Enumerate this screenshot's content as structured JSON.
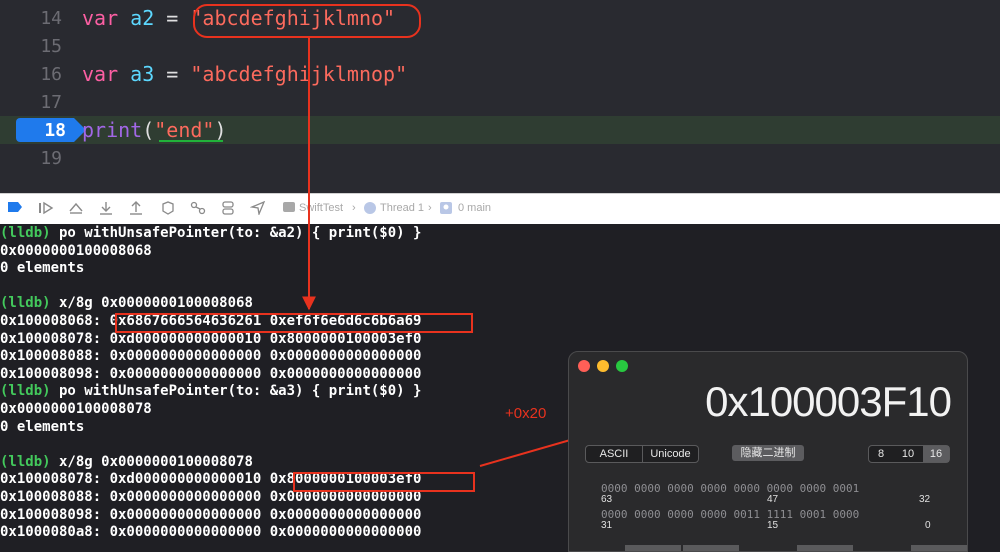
{
  "editor": {
    "lines": [
      {
        "num": "14",
        "kw": "var",
        "name": "a2",
        "eq": " = ",
        "str": "\"abcdefghijklmno\""
      },
      {
        "num": "15"
      },
      {
        "num": "16",
        "kw": "var",
        "name": "a3",
        "eq": " = ",
        "str": "\"abcdefghijklmnop\""
      },
      {
        "num": "17"
      },
      {
        "num": "18",
        "fn": "print",
        "open": "(",
        "str": "\"end\"",
        "close": ")"
      },
      {
        "num": "19"
      }
    ]
  },
  "debug_bar": {
    "target": "SwiftTest",
    "thread": "Thread 1",
    "frame": "0 main",
    "icons": [
      "breakpoint-icon",
      "continue-icon",
      "step-over-icon",
      "step-into-icon",
      "step-out-icon",
      "memory-graph-icon",
      "view-hierarchy-icon",
      "environment-icon",
      "location-icon"
    ]
  },
  "console": {
    "prompt": "(lldb)",
    "lines": [
      {
        "prompt": true,
        "text": " po withUnsafePointer(to: &a2) { print($0) }"
      },
      {
        "text": "0x0000000100008068"
      },
      {
        "text": "0 elements"
      },
      {
        "text": ""
      },
      {
        "prompt": true,
        "text": " x/8g 0x0000000100008068"
      },
      {
        "text": "0x100008068: 0x6867666564636261 0xef6f6e6d6c6b6a69"
      },
      {
        "text": "0x100008078: 0xd000000000000010 0x8000000100003ef0"
      },
      {
        "text": "0x100008088: 0x0000000000000000 0x0000000000000000"
      },
      {
        "text": "0x100008098: 0x0000000000000000 0x0000000000000000"
      },
      {
        "prompt": true,
        "text": " po withUnsafePointer(to: &a3) { print($0) }"
      },
      {
        "text": "0x0000000100008078"
      },
      {
        "text": "0 elements"
      },
      {
        "text": ""
      },
      {
        "prompt": true,
        "text": " x/8g 0x0000000100008078"
      },
      {
        "text": "0x100008078: 0xd000000000000010 0x8000000100003ef0"
      },
      {
        "text": "0x100008088: 0x0000000000000000 0x0000000000000000"
      },
      {
        "text": "0x100008098: 0x0000000000000000 0x0000000000000000"
      },
      {
        "text": "0x1000080a8: 0x0000000000000000 0x0000000000000000"
      }
    ]
  },
  "annotation": {
    "offset": "+0x20",
    "color": "#e8321e"
  },
  "calculator": {
    "display": "0x100003F10",
    "modes": [
      "ASCII",
      "Unicode"
    ],
    "binary_button": "隐藏二进制",
    "bases": [
      "8",
      "10",
      "16"
    ],
    "active_base": "16",
    "bits_row1": "0000 0000 0000 0000 0000 0000 0000 0001",
    "bits_row2": "0000 0000 0000 0000 0011 1111 0001 0000",
    "labels_row1": [
      "63",
      "47",
      "32"
    ],
    "labels_row2": [
      "31",
      "15",
      "0"
    ],
    "traffic_colors": [
      "#ff5f57",
      "#febc2e",
      "#28c840"
    ]
  }
}
